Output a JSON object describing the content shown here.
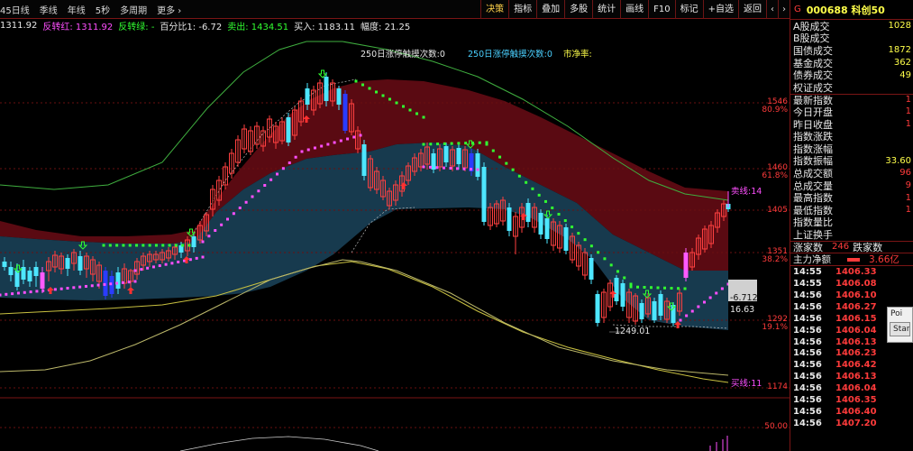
{
  "toolbar": {
    "left_items": [
      "45日线",
      "季线",
      "年线",
      "5秒",
      "多周期",
      "更多 ›"
    ],
    "right_items": [
      "决策",
      "指标",
      "叠加",
      "多股",
      "统计",
      "画线",
      "F10",
      "标记",
      "+自选",
      "返回"
    ],
    "arrows": [
      "‹",
      "›"
    ]
  },
  "infobar": [
    {
      "text": "1311.92",
      "color": "#e6e6e6"
    },
    {
      "text": "反转红: 1311.92",
      "color": "#ff4fff"
    },
    {
      "text": "反转绿: -",
      "color": "#31ff31"
    },
    {
      "text": "百分比1: -6.72",
      "color": "#e6e6e6"
    },
    {
      "text": "卖出: 1434.51",
      "color": "#31ff31"
    },
    {
      "text": "买入: 1183.11",
      "color": "#e6e6e6"
    },
    {
      "text": "幅度: 21.25",
      "color": "#e6e6e6"
    }
  ],
  "chart": {
    "header_texts": [
      "250日涨停触摸次数:0",
      "250日涨停触摸次数:0",
      "市净率:"
    ],
    "price_labels": [
      "1546",
      "80.9%",
      "1460",
      "61.8%",
      "1405",
      "1351",
      "38.2%",
      "1292",
      "19.1%",
      "1174"
    ],
    "lower_label": "50.00",
    "sell_line": "卖线:14",
    "buy_line": "买线:11",
    "low_label": "1249.01",
    "pct_label": "-6.712",
    "val_label": "16.63"
  },
  "side": {
    "tag": "G",
    "code": "000688 科创50",
    "rows": [
      {
        "label": "A股成交",
        "value": "1028"
      },
      {
        "label": "B股成交",
        "value": ""
      },
      {
        "label": "国债成交",
        "value": "1872"
      },
      {
        "label": "基金成交",
        "value": "362"
      },
      {
        "label": "债券成交",
        "value": "49"
      },
      {
        "label": "权证成交",
        "value": ""
      },
      {
        "label": "最新指数",
        "value": "1"
      },
      {
        "label": "今日开盘",
        "value": "1"
      },
      {
        "label": "昨日收盘",
        "value": "1"
      },
      {
        "label": "指数涨跌",
        "value": ""
      },
      {
        "label": "指数涨幅",
        "value": ""
      },
      {
        "label": "指数振幅",
        "value": "33.60"
      },
      {
        "label": "总成交额",
        "value": "96"
      },
      {
        "label": "总成交量",
        "value": "9"
      },
      {
        "label": "最高指数",
        "value": "1"
      },
      {
        "label": "最低指数",
        "value": "1"
      },
      {
        "label": "指数量比",
        "value": ""
      },
      {
        "label": "上证换手",
        "value": ""
      }
    ],
    "up_down": {
      "label_up": "涨家数",
      "up": "246",
      "label_down": "跌家数"
    },
    "flow": {
      "label": "主力净额",
      "value": "3.66亿"
    },
    "ticks": [
      {
        "time": "14:55",
        "price": "1406.33"
      },
      {
        "time": "14:55",
        "price": "1406.08"
      },
      {
        "time": "14:56",
        "price": "1406.10"
      },
      {
        "time": "14:56",
        "price": "1406.27"
      },
      {
        "time": "14:56",
        "price": "1406.15"
      },
      {
        "time": "14:56",
        "price": "1406.04"
      },
      {
        "time": "14:56",
        "price": "1406.13"
      },
      {
        "time": "14:56",
        "price": "1406.23"
      },
      {
        "time": "14:56",
        "price": "1406.42"
      },
      {
        "time": "14:56",
        "price": "1406.13"
      },
      {
        "time": "14:56",
        "price": "1406.04"
      },
      {
        "time": "14:56",
        "price": "1406.35"
      },
      {
        "time": "14:56",
        "price": "1406.40"
      },
      {
        "time": "14:56",
        "price": "1407.20"
      }
    ],
    "popup": {
      "title": "Poi",
      "button": "Start"
    }
  }
}
